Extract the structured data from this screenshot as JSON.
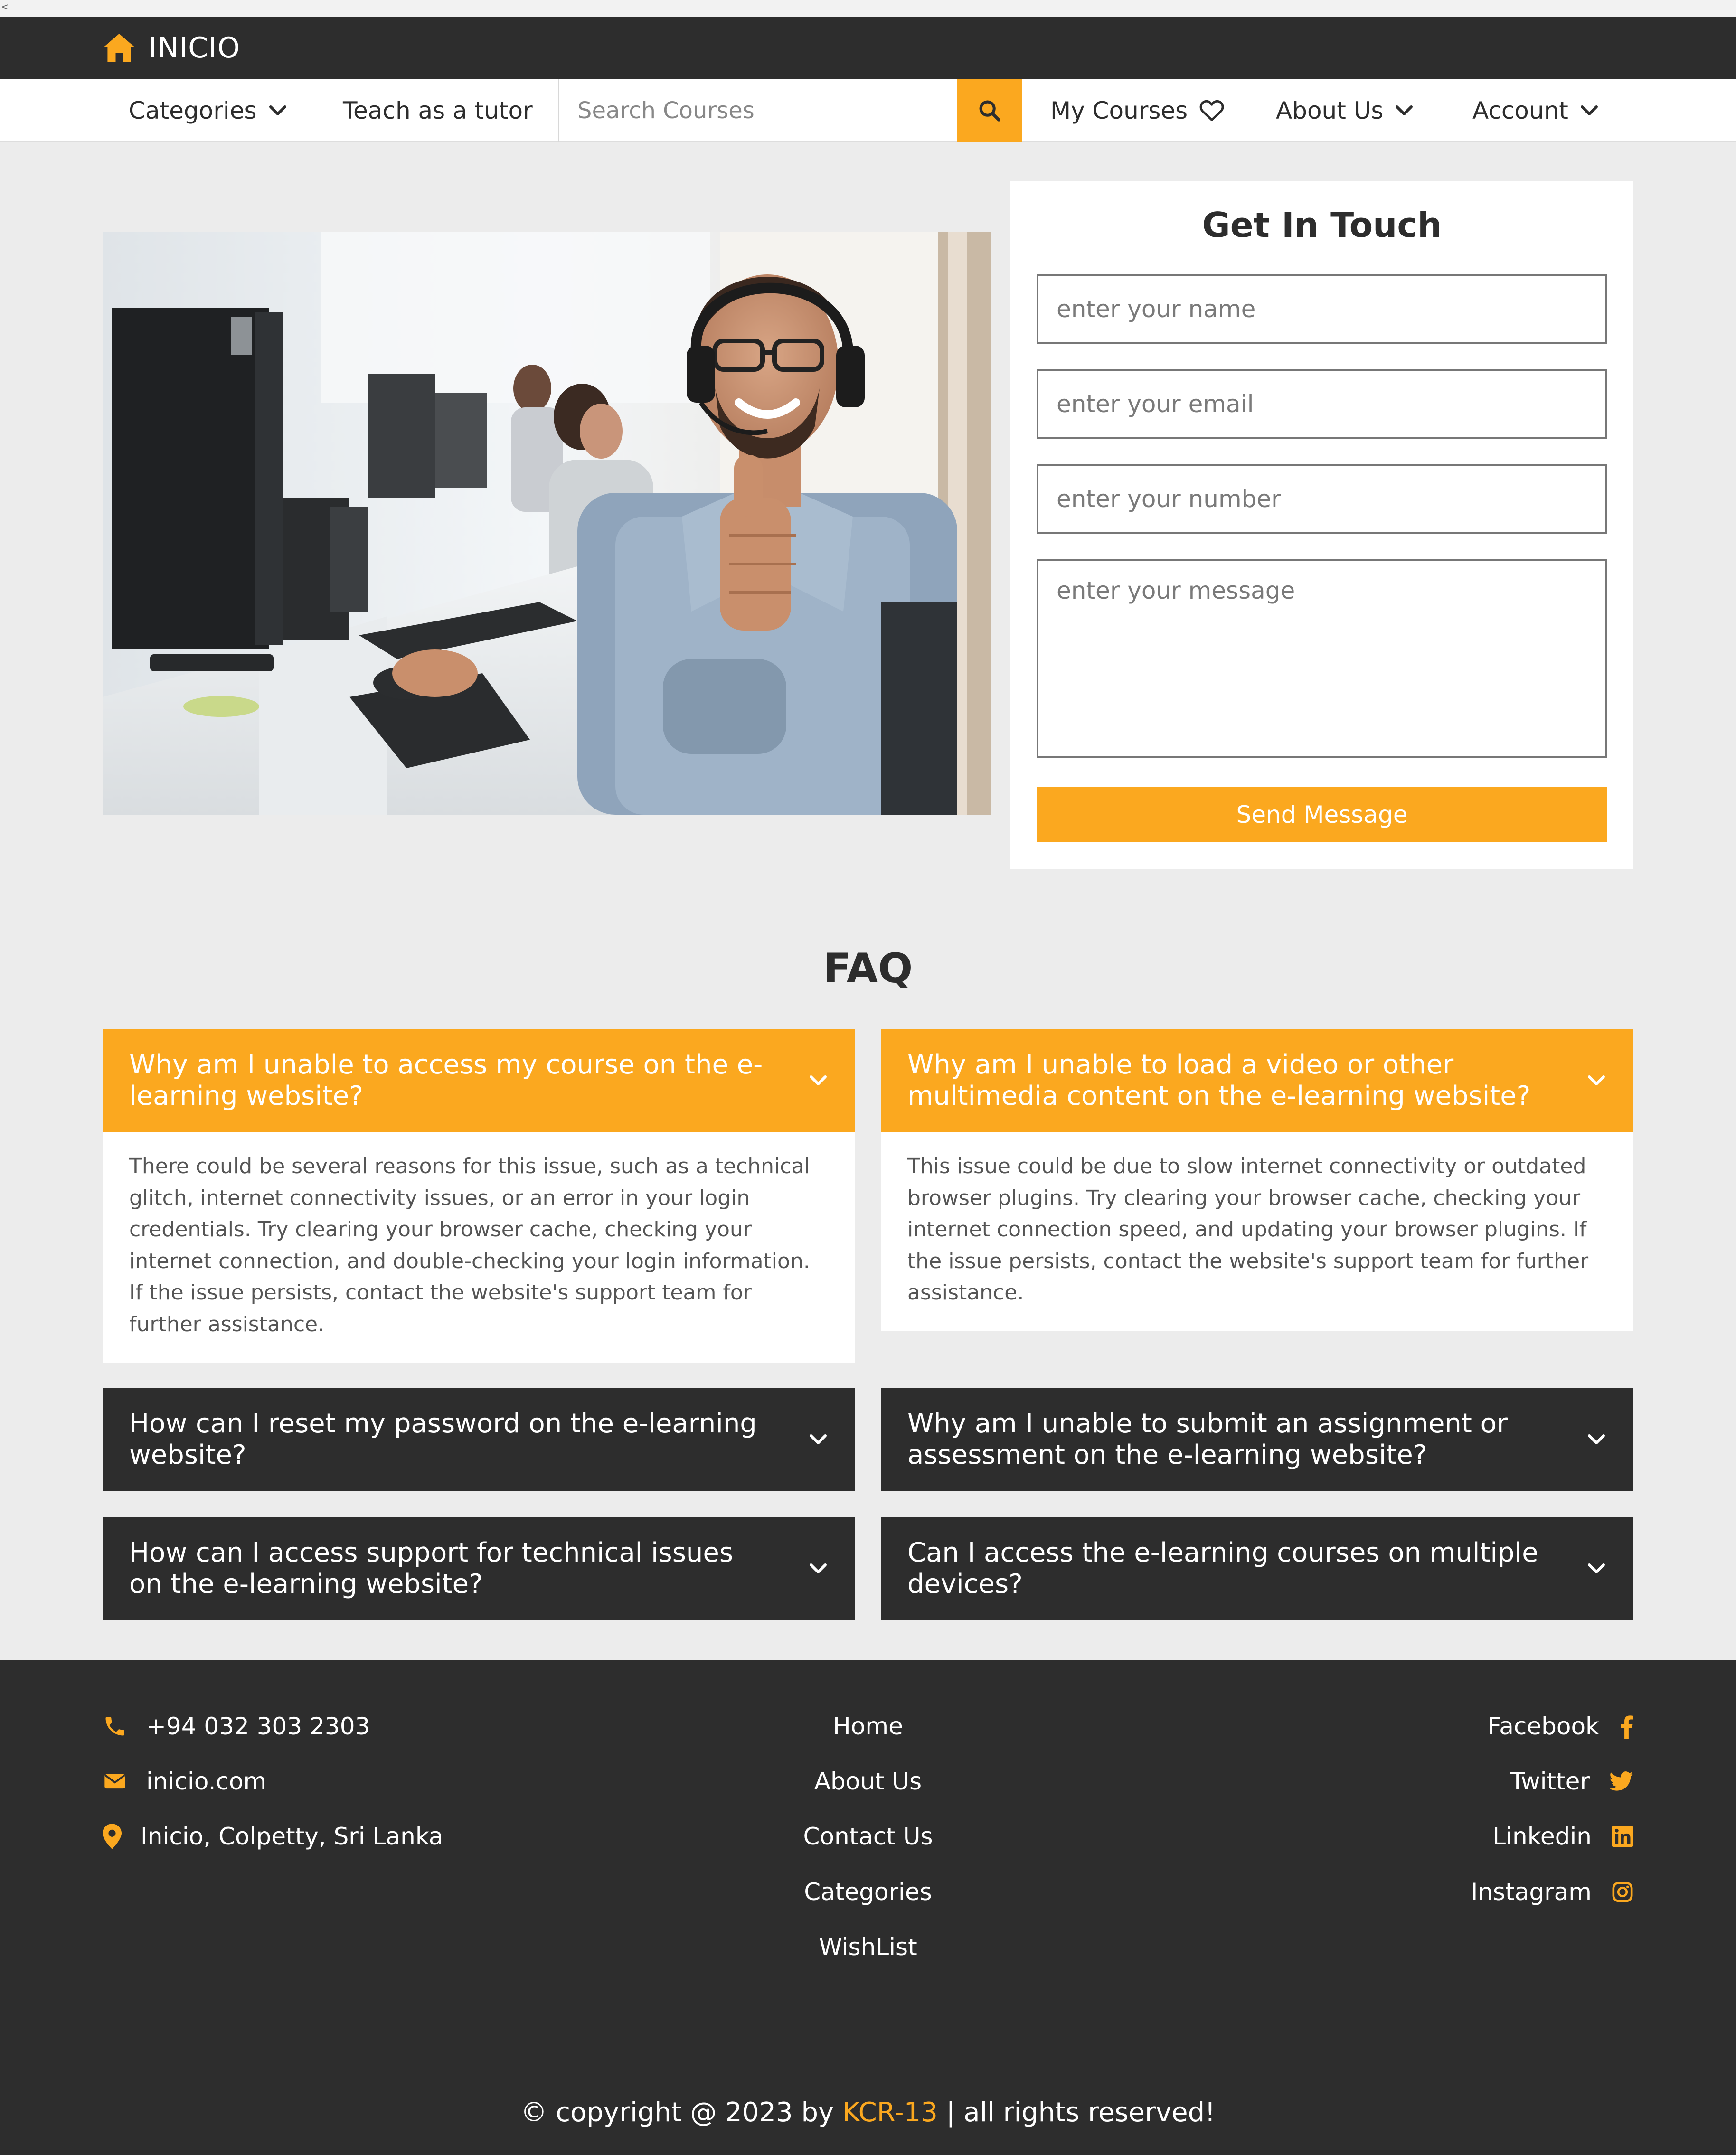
{
  "top_glyph": "<",
  "brand": {
    "name": "INICIO",
    "icon": "home-icon"
  },
  "nav": {
    "categories": "Categories",
    "teach": "Teach as a tutor",
    "search_placeholder": "Search Courses",
    "my_courses": "My Courses",
    "about": "About Us",
    "account": "Account"
  },
  "contact": {
    "title": "Get In Touch",
    "name_placeholder": "enter your name",
    "email_placeholder": "enter your email",
    "number_placeholder": "enter your number",
    "message_placeholder": "enter your message",
    "send_label": "Send Message"
  },
  "faq": {
    "title": "FAQ",
    "items": [
      {
        "q": "Why am I unable to access my course on the e-learning website?",
        "a": "There could be several reasons for this issue, such as a technical glitch, internet connectivity issues, or an error in your login credentials. Try clearing your browser cache, checking your internet connection, and double-checking your login information. If the issue persists, contact the website's support team for further assistance.",
        "open": true
      },
      {
        "q": "Why am I unable to load a video or other multimedia content on the e-learning website?",
        "a": "This issue could be due to slow internet connectivity or outdated browser plugins. Try clearing your browser cache, checking your internet connection speed, and updating your browser plugins. If the issue persists, contact the website's support team for further assistance.",
        "open": true
      },
      {
        "q": "How can I reset my password on the e-learning website?",
        "open": false
      },
      {
        "q": "Why am I unable to submit an assignment or assessment on the e-learning website?",
        "open": false
      },
      {
        "q": "How can I access support for technical issues on the e-learning website?",
        "open": false
      },
      {
        "q": "Can I access the e-learning courses on multiple devices?",
        "open": false
      }
    ]
  },
  "footer": {
    "phone": "+94 032 303 2303",
    "email": "inicio.com",
    "address": "Inicio, Colpetty, Sri Lanka",
    "links": [
      "Home",
      "About Us",
      "Contact Us",
      "Categories",
      "WishList"
    ],
    "social": [
      "Facebook",
      "Twitter",
      "Linkedin",
      "Instagram"
    ],
    "copyright_prefix": "© copyright @ 2023 by ",
    "copyright_brand": "KCR-13",
    "copyright_suffix": " | all rights reserved!"
  },
  "colors": {
    "accent": "#fba81f",
    "dark": "#2d2d2d",
    "background": "#ececec"
  }
}
